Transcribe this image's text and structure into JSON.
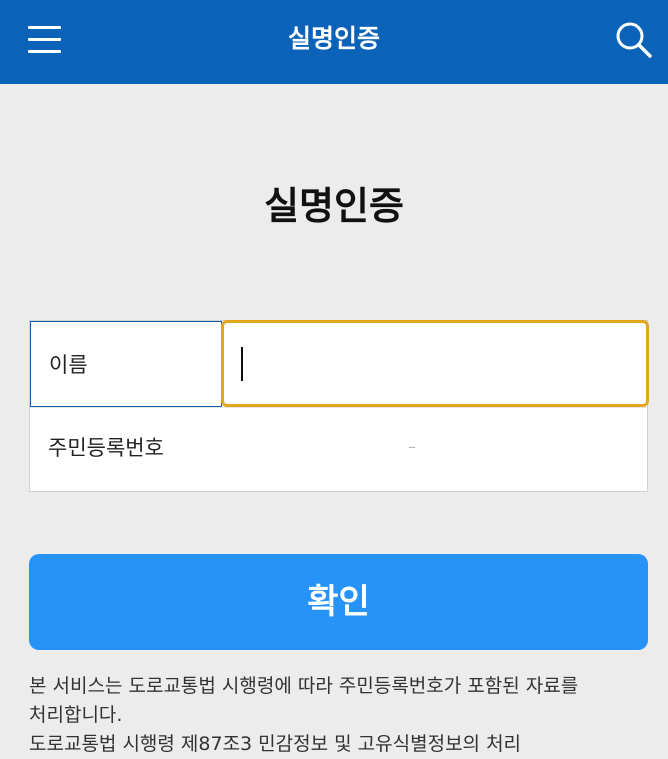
{
  "header": {
    "title": "실명인증",
    "menu_icon": "hamburger-menu-icon",
    "search_icon": "magnifier-search-icon",
    "background_color": "#0a63b8"
  },
  "page": {
    "heading": "실명인증"
  },
  "form": {
    "name_label": "이름",
    "name_value": "",
    "rrn_label": "주민등록번호",
    "rrn_separator": "–",
    "focus_color": "#e3a61c"
  },
  "actions": {
    "confirm_label": "확인",
    "confirm_color": "#2793f6"
  },
  "notice": {
    "line1": "본 서비스는 도로교통법 시행령에 따라 주민등록번호가 포함된 자료를",
    "line2": "처리합니다.",
    "line3": "도로교통법 시행령 제87조3 민감정보 및 고유식별정보의 처리"
  }
}
